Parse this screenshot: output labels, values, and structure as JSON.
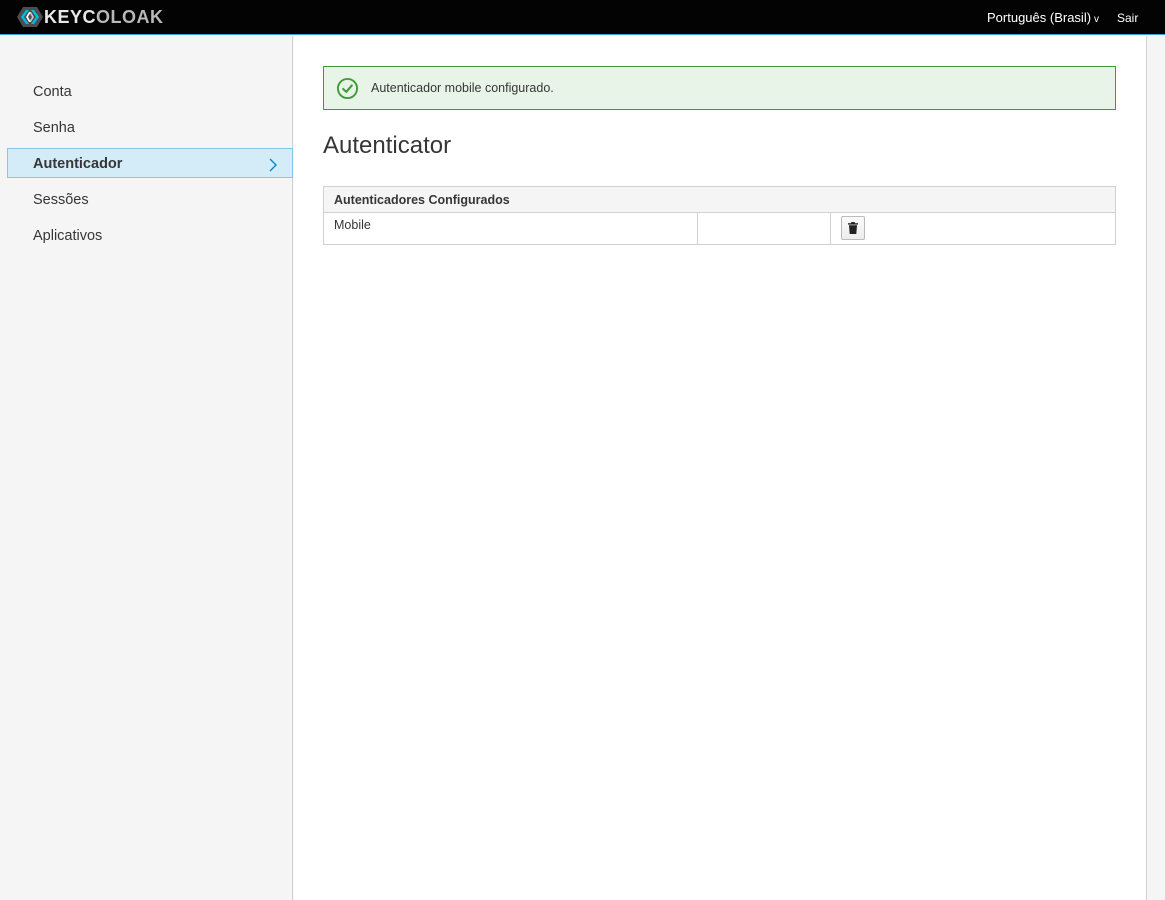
{
  "header": {
    "brand_prefix": "KEYC",
    "brand_suffix": "LOAK",
    "brand_o": "O",
    "language": "Português (Brasil)",
    "language_caret": "v",
    "logout": "Sair",
    "accent_color": "#39a5dc"
  },
  "sidebar": {
    "items": [
      {
        "label": "Conta",
        "active": false
      },
      {
        "label": "Senha",
        "active": false
      },
      {
        "label": "Autenticador",
        "active": true
      },
      {
        "label": "Sessões",
        "active": false
      },
      {
        "label": "Aplicativos",
        "active": false
      }
    ],
    "active_chevron": "›"
  },
  "main": {
    "alert": {
      "type": "success",
      "icon": "check-circle-icon",
      "message": "Autenticador mobile configurado.",
      "color": "#3f9c35"
    },
    "title": "Autenticator",
    "table": {
      "header": "Autenticadores Configurados",
      "rows": [
        {
          "name": "Mobile",
          "extra": "",
          "action_icon": "trash-icon"
        }
      ]
    }
  }
}
